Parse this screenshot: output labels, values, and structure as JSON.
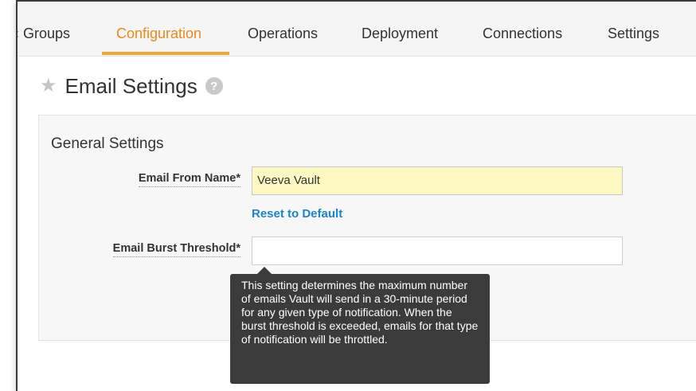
{
  "tabs": [
    {
      "label": "Groups"
    },
    {
      "label": "Configuration"
    },
    {
      "label": "Operations"
    },
    {
      "label": "Deployment"
    },
    {
      "label": "Connections"
    },
    {
      "label": "Settings"
    }
  ],
  "tab_partial_prefix": "‹",
  "active_tab": "Configuration",
  "page": {
    "title": "Email Settings",
    "star_icon": "star-icon",
    "help_icon": "question-circle-icon",
    "help_glyph": "?"
  },
  "section": {
    "title": "General Settings"
  },
  "fields": {
    "from_name": {
      "label": "Email From Name*",
      "value": "Veeva Vault",
      "reset_link": "Reset to Default"
    },
    "burst_threshold": {
      "label": "Email Burst Threshold*",
      "value": ""
    }
  },
  "tooltip": {
    "text": "This setting determines the maximum number of emails Vault will send in a 30-minute period for any given type of notification. When the burst threshold is exceeded, emails for that type of notification will be throttled."
  },
  "colors": {
    "active_tab": "#e98a1d",
    "link": "#1c85c7",
    "highlight_input": "#fdf8c2",
    "tooltip_bg": "#3b3b3b"
  }
}
